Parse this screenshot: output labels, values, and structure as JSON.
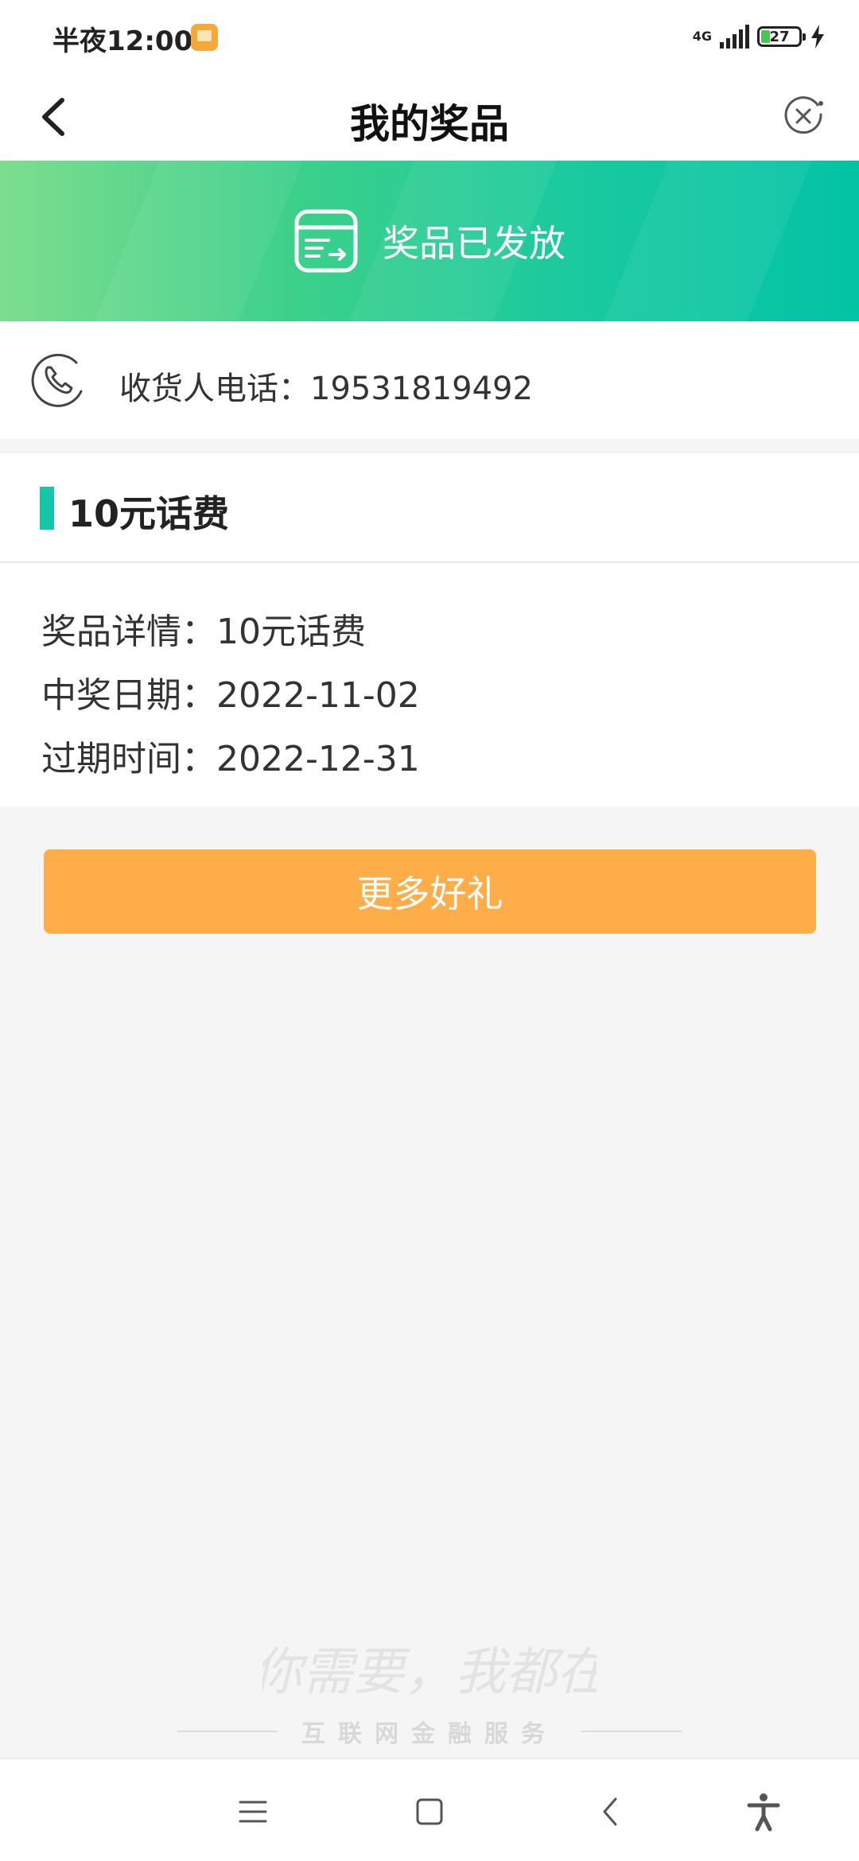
{
  "status_bar": {
    "time": "半夜12:00",
    "network": "4G",
    "battery_level": "27"
  },
  "nav": {
    "title": "我的奖品"
  },
  "banner": {
    "text": "奖品已发放",
    "gradient_start": "#7ddd8e",
    "gradient_end": "#03c3a5"
  },
  "contact": {
    "label": "收货人电话：19531819492"
  },
  "prize": {
    "title": "10元话费",
    "details": [
      "奖品详情：10元话费",
      "中奖日期：2022-11-02",
      "过期时间：2022-12-31"
    ],
    "accent_color": "#15c6a8"
  },
  "actions": {
    "more_gifts_label": "更多好礼",
    "button_color": "#fead48"
  },
  "footer": {
    "slogan": "你需要，我都在",
    "tagline": "互联网金融服务"
  },
  "system_nav": {
    "icons": [
      "menu-icon",
      "home-icon",
      "back-icon",
      "accessibility-icon"
    ]
  }
}
